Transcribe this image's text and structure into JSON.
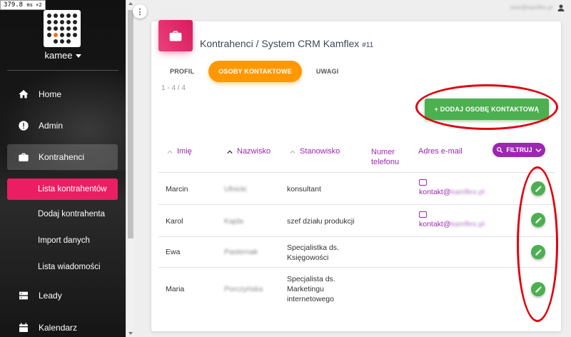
{
  "overlay": {
    "fps": "379.8",
    "fps_unit": "ms ×2"
  },
  "sidebar": {
    "username": "kamee",
    "nav": [
      {
        "label": "Home",
        "icon": "home-icon"
      },
      {
        "label": "Admin",
        "icon": "alert-circle-icon"
      },
      {
        "label": "Kontrahenci",
        "icon": "briefcase-icon"
      },
      {
        "label": "Leady",
        "icon": "server-icon"
      },
      {
        "label": "Kalendarz",
        "icon": "calendar-icon"
      }
    ],
    "sub_items": [
      {
        "label": "Lista kontrahentów",
        "active": true
      },
      {
        "label": "Dodaj kontrahenta",
        "active": false
      },
      {
        "label": "Import danych",
        "active": false
      },
      {
        "label": "Lista wiadomości",
        "active": false
      }
    ]
  },
  "topbar": {
    "user_email": "user@kamflex.pl"
  },
  "card": {
    "title": "Kontrahenci / System CRM Kamflex",
    "title_suffix": "#11",
    "tabs": [
      {
        "label": "PROFIL",
        "active": false
      },
      {
        "label": "OSOBY KONTAKTOWE",
        "active": true
      },
      {
        "label": "UWAGI",
        "active": false
      }
    ],
    "count": "1 - 4 / 4",
    "add_button": "+ DODAJ OSOBĘ KONTAKTOWĄ",
    "filter_button": "FILTRUJ",
    "columns": [
      "Imię",
      "Nazwisko",
      "Stanowisko",
      "Numer telefonu",
      "Adres e-mail"
    ],
    "rows": [
      {
        "first": "Marcin",
        "last": "Ufnicki",
        "position": "konsultant",
        "phone": "",
        "email_prefix": "kontakt@",
        "email_domain": "kamflex.pl"
      },
      {
        "first": "Karol",
        "last": "Kajda",
        "position": "szef działu produkcji",
        "phone": "",
        "email_prefix": "kontakt@",
        "email_domain": "kamflex.pl"
      },
      {
        "first": "Ewa",
        "last": "Pasternak",
        "position": "Specjalistka ds. Księgowości",
        "phone": "",
        "email_prefix": "",
        "email_domain": ""
      },
      {
        "first": "Maria",
        "last": "Porczyńska",
        "position": "Specjalista ds. Marketingu internetowego",
        "phone": "",
        "email_prefix": "",
        "email_domain": ""
      }
    ]
  },
  "colors": {
    "accent_pink": "#e91e63",
    "tab_orange": "#ff9800",
    "success_green": "#4caf50",
    "purple": "#9c27b0",
    "annotation_red": "#e3000f"
  }
}
